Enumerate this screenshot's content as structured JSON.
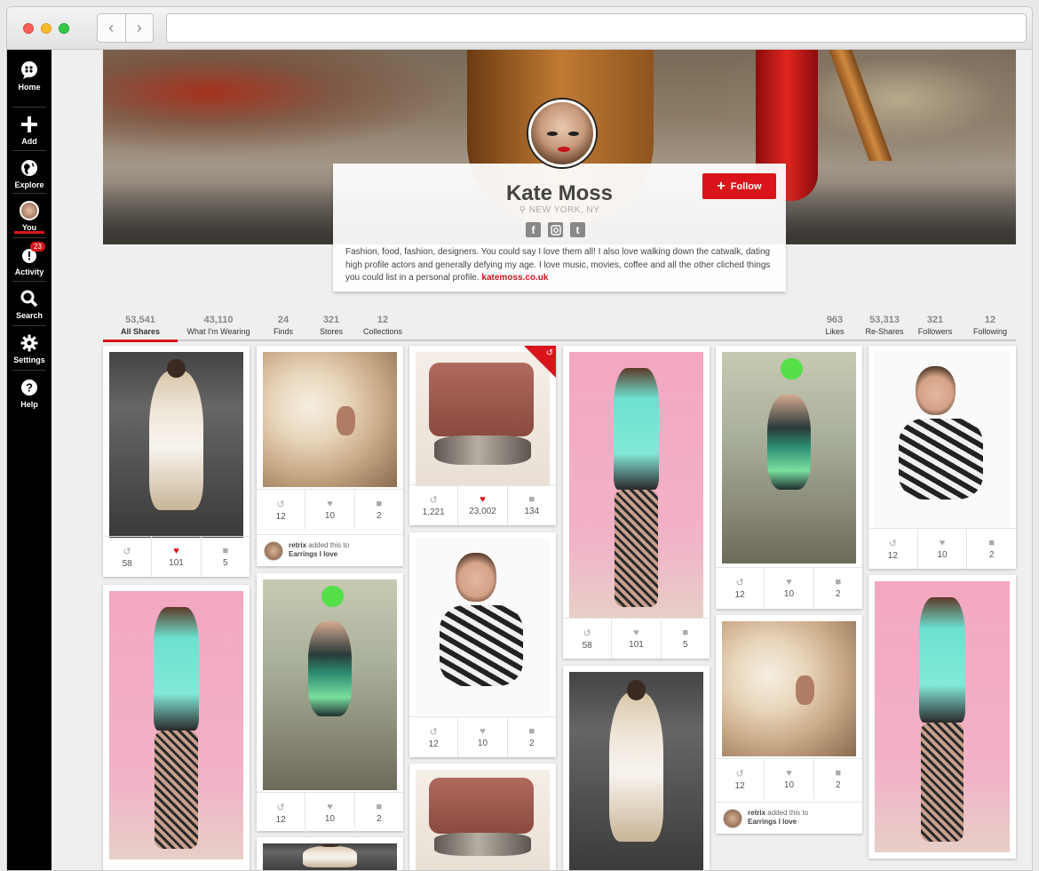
{
  "sidebar": {
    "items": [
      {
        "label": "Home",
        "icon": "chat-bubble-icon"
      },
      {
        "label": "Add",
        "icon": "plus-icon"
      },
      {
        "label": "Explore",
        "icon": "globe-icon"
      },
      {
        "label": "You",
        "icon": "avatar-icon"
      },
      {
        "label": "Activity",
        "icon": "alert-icon",
        "badge": "23"
      },
      {
        "label": "Search",
        "icon": "search-icon"
      },
      {
        "label": "Settings",
        "icon": "gear-icon"
      },
      {
        "label": "Help",
        "icon": "help-icon"
      }
    ]
  },
  "profile": {
    "name": "Kate Moss",
    "location": "NEW YORK, NY",
    "bio": "Fashion, food, fashion, designers. You could say I love them all! I also love walking down the catwalk, dating high profile actors and generally defying my age. I love music, movies, coffee and all the other cliched things you could list in a personal profile.",
    "link": "katemoss.co.uk",
    "follow_label": "Follow",
    "social": [
      "f",
      "ig",
      "t"
    ]
  },
  "stats_left": [
    {
      "num": "53,541",
      "label": "All Shares",
      "active": true
    },
    {
      "num": "43,110",
      "label": "What I'm Wearing"
    },
    {
      "num": "24",
      "label": "Finds"
    },
    {
      "num": "321",
      "label": "Stores"
    },
    {
      "num": "12",
      "label": "Collections"
    }
  ],
  "stats_right": [
    {
      "num": "963",
      "label": "Likes"
    },
    {
      "num": "53,313",
      "label": "Re-Shares"
    },
    {
      "num": "321",
      "label": "Followers"
    },
    {
      "num": "12",
      "label": "Following"
    }
  ],
  "pins": [
    {
      "reshare": "58",
      "likes": "101",
      "comments": "5",
      "liked": true
    },
    {
      "reshare": "12",
      "likes": "10",
      "comments": "2",
      "added_user": "retrix",
      "added_text": "added this to",
      "added_board": "Earrings I love"
    },
    {
      "reshare": "1,221",
      "likes": "23,002",
      "comments": "134",
      "liked": true
    },
    {
      "reshare": "58",
      "likes": "101",
      "comments": "5"
    },
    {
      "reshare": "12",
      "likes": "10",
      "comments": "2"
    },
    {
      "reshare": "12",
      "likes": "10",
      "comments": "2"
    },
    {
      "reshare": "12",
      "likes": "10",
      "comments": "2"
    },
    {
      "reshare": "12",
      "likes": "10",
      "comments": "2"
    },
    {
      "reshare": "12",
      "likes": "10",
      "comments": "2",
      "added_user": "retrix",
      "added_text": "added this to",
      "added_board": "Earrings I love"
    }
  ],
  "colors": {
    "accent": "#d9141a",
    "sidebar": "#000000"
  }
}
